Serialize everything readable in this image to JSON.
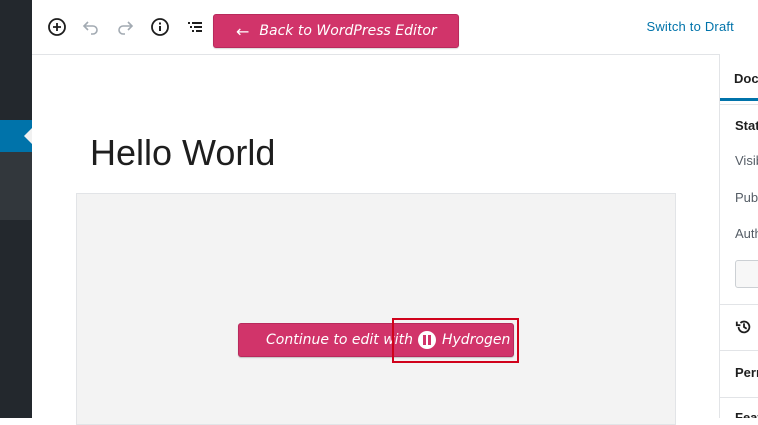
{
  "toolbar": {
    "back_label": "Back to WordPress Editor",
    "switch_draft_label": "Switch to Draft",
    "icons": [
      "add-block-icon",
      "undo-icon",
      "redo-icon",
      "info-icon",
      "outline-icon"
    ]
  },
  "editor": {
    "title": "Hello World",
    "continue_label_prefix": "Continue to edit with",
    "continue_label_brand": "Hydrogen"
  },
  "settings": {
    "tab_label": "Document",
    "status_heading": "Status & Visibility",
    "visibility_label": "Visibility",
    "publish_label": "Publish",
    "author_label": "Author",
    "permalink_label": "Permalink",
    "featured_label": "Featured Image"
  },
  "colors": {
    "accent_pink": "#d1346a",
    "admin_blue": "#0073aa",
    "admin_dark": "#23282d",
    "highlight_red": "#d0021b"
  }
}
